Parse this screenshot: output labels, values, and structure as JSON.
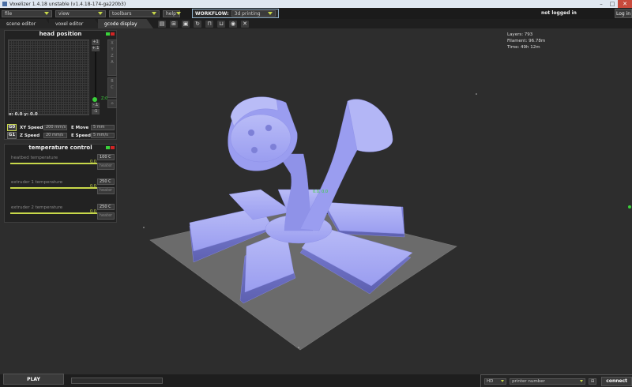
{
  "window": {
    "title": "Voxelizer 1.4.18 unstable (v1.4.18-174-ga220b3)",
    "minimize": "–",
    "maximize": "□",
    "close": "✕"
  },
  "menubar": {
    "menus": [
      {
        "label": "file"
      },
      {
        "label": "view"
      },
      {
        "label": "toolbars"
      },
      {
        "label": "help"
      }
    ],
    "workflow_label": "WORKFLOW:",
    "workflow_value": "3d printing",
    "login_status": "not logged in",
    "login_button": "Log in"
  },
  "tabs": [
    {
      "label": "scene editor"
    },
    {
      "label": "voxel editor"
    },
    {
      "label": "gcode display"
    }
  ],
  "toolbar_icons": [
    "open-icon",
    "voxel-icon",
    "save-icon",
    "rotate-icon",
    "lock-icon",
    "unlock-icon",
    "camera-icon",
    "settings-icon"
  ],
  "stats": {
    "layers": "Layers: 793",
    "filament": "Filament: 96.78m",
    "time": "Time: 49h 12m"
  },
  "head_position": {
    "title": "head position",
    "xy_readout": "x: 0.0 y: 0.0",
    "z_label": "Z:0",
    "z_buttons": [
      "+1",
      "+.1",
      "-.1",
      "-1"
    ],
    "axis_buttons": [
      "X",
      "Y",
      "Z",
      "A",
      "B",
      "C"
    ],
    "home_button": "⌂",
    "rows": [
      {
        "g": "G0",
        "speed_label": "XY Speed",
        "speed_value": "200",
        "speed_unit": "mm/s",
        "move_label": "E Move",
        "move_value": "5",
        "move_unit": "mm"
      },
      {
        "g": "G1",
        "speed_label": "Z Speed",
        "speed_value": "20",
        "speed_unit": "mm/s",
        "move_label": "E Speed",
        "move_value": "5",
        "move_unit": "mm/s"
      }
    ]
  },
  "temperature": {
    "title": "temperature control",
    "rows": [
      {
        "label": "heatbed temperature",
        "value": "0.0",
        "target": "100",
        "unit": "C",
        "button": "heater"
      },
      {
        "label": "extruder 1 temperature",
        "value": "0.0",
        "target": "250",
        "unit": "C",
        "button": "heater"
      },
      {
        "label": "extruder 2 temperature",
        "value": "0.0",
        "target": "250",
        "unit": "C",
        "button": "heater"
      }
    ]
  },
  "bottom": {
    "play_label": "PLAY",
    "printer_type": "HD",
    "printer_number": "printer number",
    "connect_label": "connect",
    "progress": 0
  },
  "colors": {
    "accent": "#c8d84a",
    "model": "#9a9df0",
    "bed": "#6b6b6b",
    "green": "#3ad13a",
    "red": "#d12424"
  }
}
